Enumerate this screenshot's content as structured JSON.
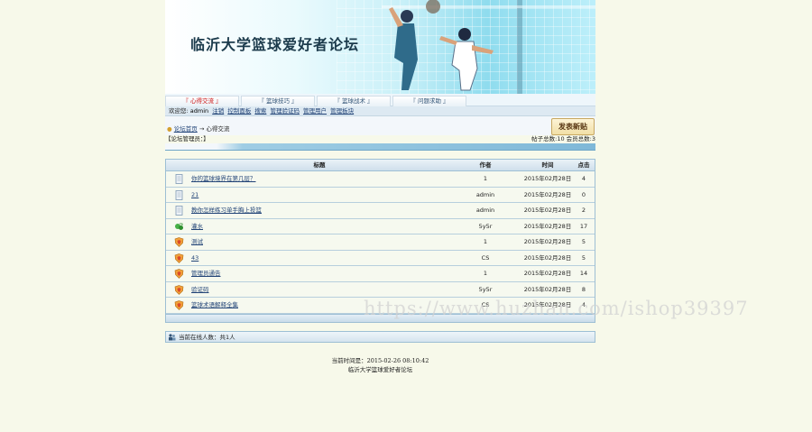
{
  "banner": {
    "title": "临沂大学篮球爱好者论坛"
  },
  "nav": {
    "tabs": [
      {
        "label": "『 心得交流 』",
        "active": true
      },
      {
        "label": "『 篮球技巧 』",
        "active": false
      },
      {
        "label": "『 篮球战术 』",
        "active": false
      },
      {
        "label": "『 问题求助 』",
        "active": false
      }
    ]
  },
  "welcome": {
    "prefix": "欢迎您:",
    "user": "admin",
    "links": [
      "注销",
      "控制面板",
      "搜索",
      "管理验证码",
      "管理用户",
      "管理板块"
    ]
  },
  "breadcrumb": {
    "home": "论坛首页",
    "arrow": "→",
    "current": "心得交流"
  },
  "post_button": "发表新贴",
  "admins": {
    "left": "【论坛管理员：】",
    "right": "帖子总数:10 会员总数:3"
  },
  "table": {
    "headers": {
      "title": "标题",
      "author": "作者",
      "time": "时间",
      "hits": "点击"
    },
    "rows": [
      {
        "icon": "doc",
        "title": "你的篮球境界在第几层？",
        "author": "1",
        "time": "2015年02月28日",
        "hits": "4"
      },
      {
        "icon": "doc",
        "title": "21",
        "author": "admin",
        "time": "2015年02月28日",
        "hits": "0"
      },
      {
        "icon": "doc",
        "title": "教你怎样练习单手胸上投篮",
        "author": "admin",
        "time": "2015年02月28日",
        "hits": "2"
      },
      {
        "icon": "green",
        "title": "灌水",
        "author": "5y5r",
        "time": "2015年02月28日",
        "hits": "17"
      },
      {
        "icon": "shield",
        "title": "测试",
        "author": "1",
        "time": "2015年02月28日",
        "hits": "5"
      },
      {
        "icon": "shield",
        "title": "43",
        "author": "CS",
        "time": "2015年02月28日",
        "hits": "5"
      },
      {
        "icon": "shield",
        "title": "管理员通告",
        "author": "1",
        "time": "2015年02月28日",
        "hits": "14"
      },
      {
        "icon": "shield",
        "title": "验证码",
        "author": "5y5r",
        "time": "2015年02月28日",
        "hits": "8"
      },
      {
        "icon": "shield",
        "title": "篮球术语解释全集",
        "author": "CS",
        "time": "2015年02月28日",
        "hits": "4"
      }
    ]
  },
  "online": "当前在线人数：共1人",
  "footer": {
    "time": "当前时间是：2015-02-26 08:10:42",
    "name": "临沂大学篮球爱好者论坛"
  },
  "watermark": "https://www.huzhan.com/ishop39397"
}
